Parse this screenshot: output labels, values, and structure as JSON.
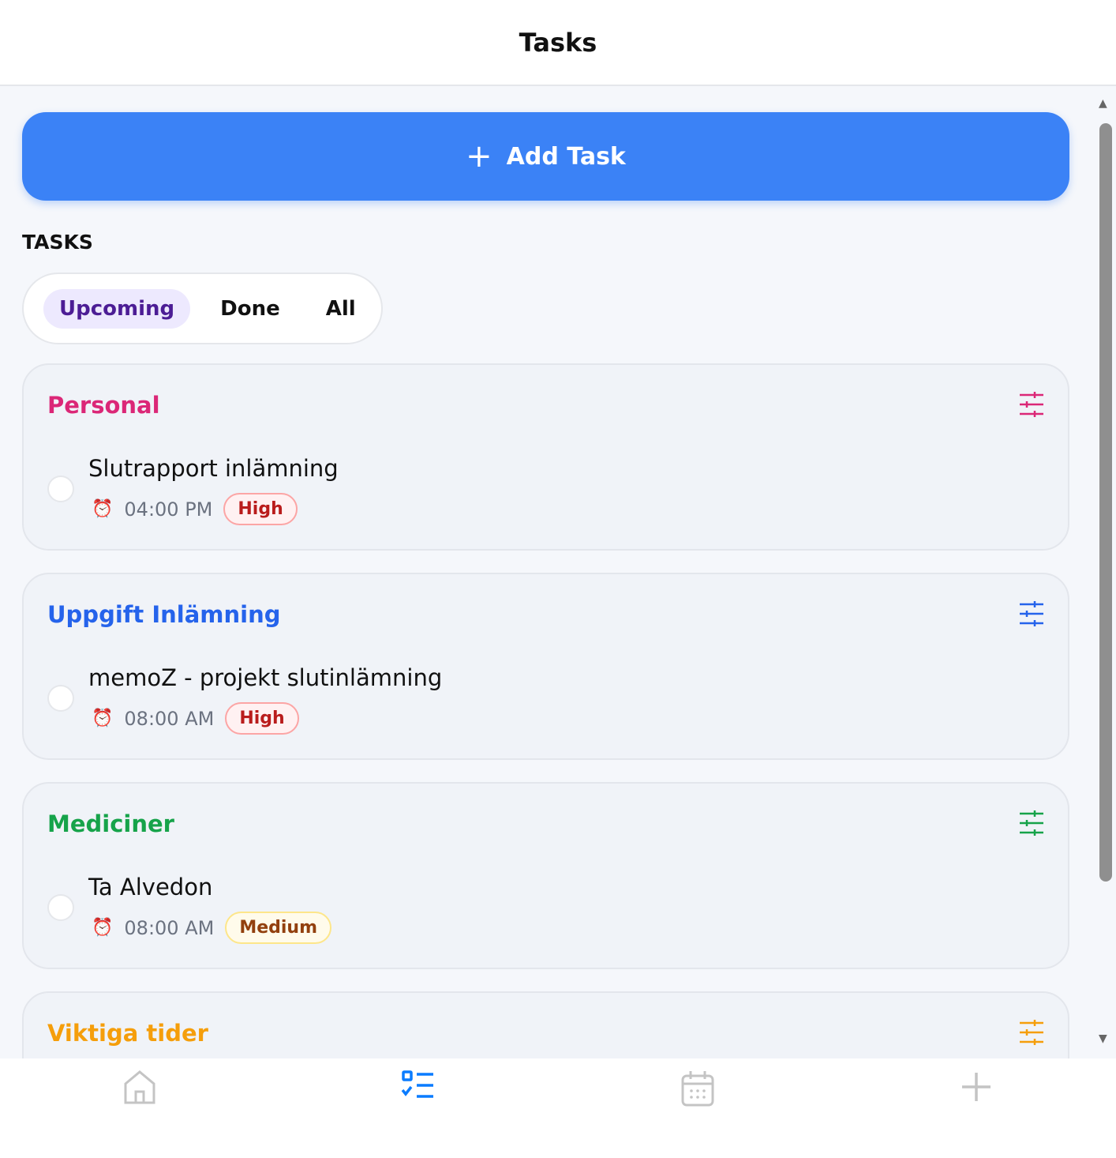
{
  "header": {
    "title": "Tasks"
  },
  "add_button": {
    "icon": "plus-icon",
    "label": "Add Task"
  },
  "section_label": "TASKS",
  "filters": [
    {
      "label": "Upcoming",
      "active": true
    },
    {
      "label": "Done",
      "active": false
    },
    {
      "label": "All",
      "active": false
    }
  ],
  "categories": [
    {
      "title": "Personal",
      "color": "#db2777",
      "tasks": [
        {
          "name": "Slutrapport inlämning",
          "time": "04:00 PM",
          "priority": "High"
        }
      ]
    },
    {
      "title": "Uppgift Inlämning",
      "color": "#2563eb",
      "tasks": [
        {
          "name": "memoZ - projekt slutinlämning",
          "time": "08:00 AM",
          "priority": "High"
        }
      ]
    },
    {
      "title": "Mediciner",
      "color": "#16a34a",
      "tasks": [
        {
          "name": "Ta Alvedon",
          "time": "08:00 AM",
          "priority": "Medium"
        }
      ]
    },
    {
      "title": "Viktiga tider",
      "color": "#f59e0b",
      "tasks": []
    }
  ],
  "bottom_nav": [
    {
      "icon": "home-icon",
      "active": false
    },
    {
      "icon": "task-list-icon",
      "active": true
    },
    {
      "icon": "calendar-icon",
      "active": false
    },
    {
      "icon": "plus-icon",
      "active": false
    }
  ],
  "colors": {
    "accent": "#3b82f6",
    "nav_active": "#0a7cff",
    "nav_inactive": "#c4c4c4"
  }
}
